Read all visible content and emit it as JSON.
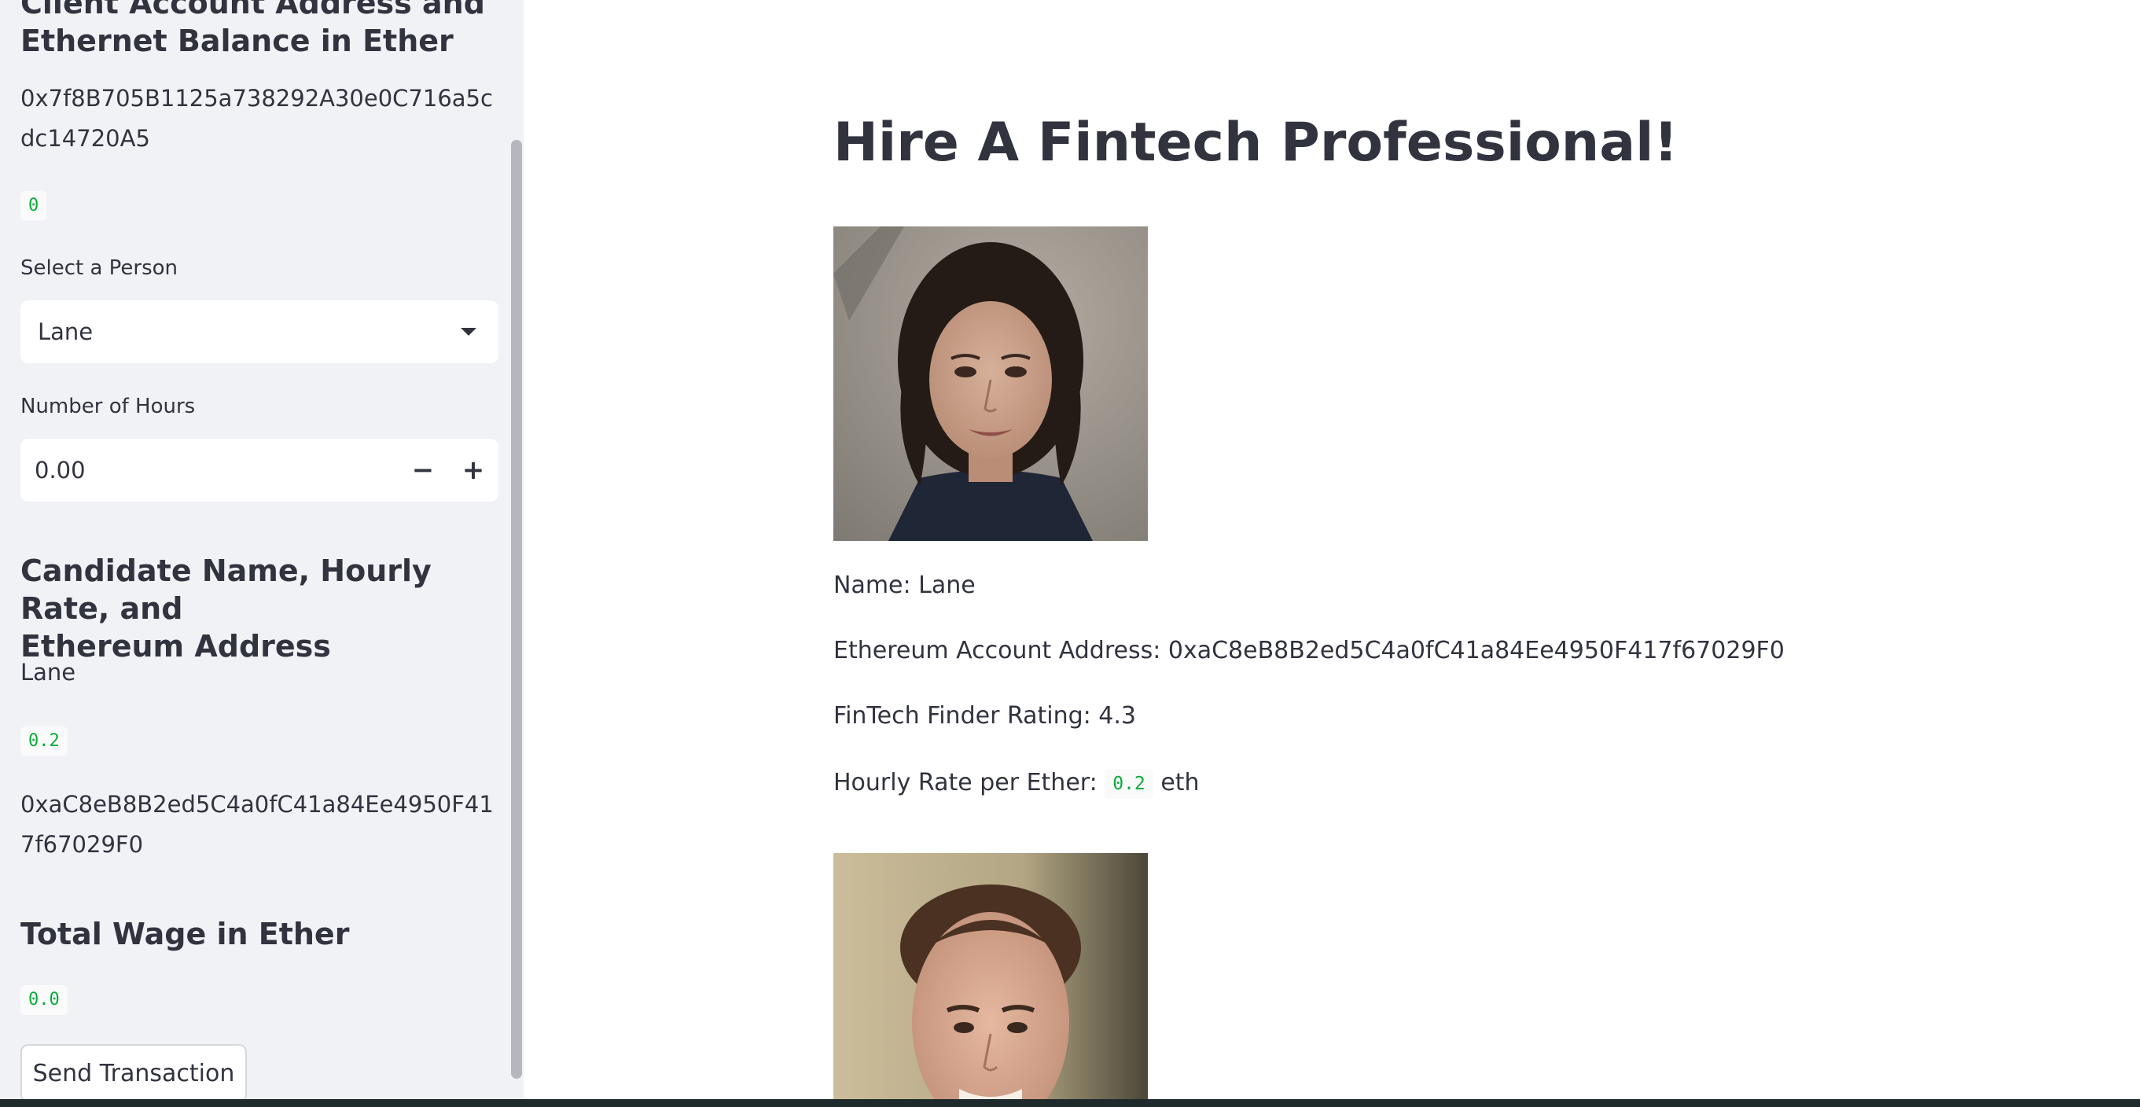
{
  "sidebar": {
    "heading_client": "Client Account Address and\nEthernet Balance in Ether",
    "client_address": "0x7f8B705B1125a738292A30e0C716a5cdc14720A5",
    "client_balance": "0",
    "select_label": "Select a Person",
    "select_value": "Lane",
    "hours_label": "Number of Hours",
    "hours_value": "0.00",
    "decrement_symbol": "−",
    "increment_symbol": "+",
    "heading_candidate": "Candidate Name, Hourly Rate, and\nEthereum Address",
    "candidate_name": "Lane",
    "candidate_rate": "0.2",
    "candidate_address": "0xaC8eB8B2ed5C4a0fC41a84Ee4950F417f67029F0",
    "heading_wage": "Total Wage in Ether",
    "total_wage": "0.0",
    "send_button": "Send Transaction"
  },
  "main": {
    "title": "Hire A Fintech Professional!",
    "profiles": [
      {
        "name_line": "Name: Lane",
        "address_line": "Ethereum Account Address: 0xaC8eB8B2ed5C4a0fC41a84Ee4950F417f67029F0",
        "rating_line": "FinTech Finder Rating: 4.3",
        "rate_prefix": "Hourly Rate per Ether:",
        "rate_value": "0.2",
        "rate_suffix": "eth"
      }
    ]
  },
  "icons": {
    "select_caret": "chevron-down-icon"
  }
}
